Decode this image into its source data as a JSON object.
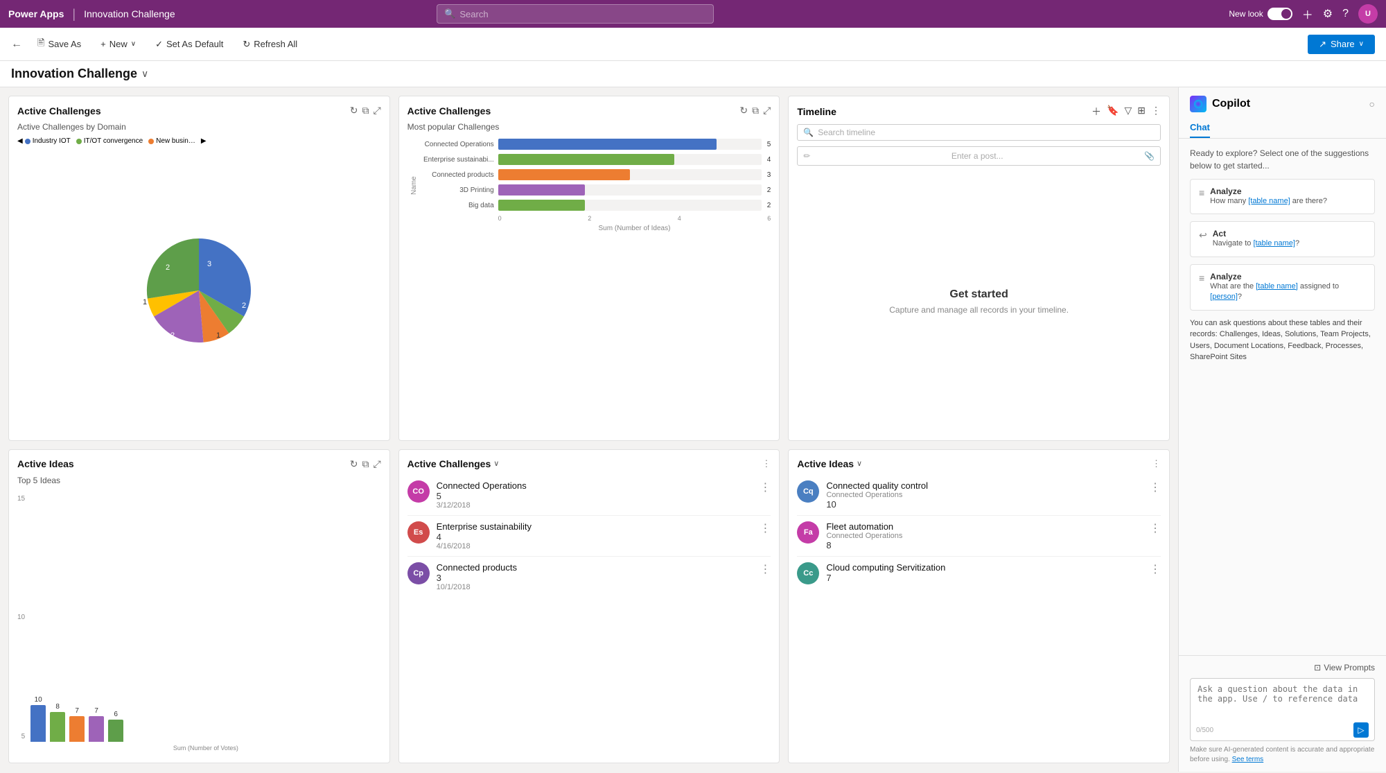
{
  "topnav": {
    "brand": "Power Apps",
    "separator": "|",
    "title": "Innovation Challenge",
    "search_placeholder": "Search",
    "new_look_label": "New look",
    "avatar_initials": "U"
  },
  "toolbar": {
    "back_icon": "←",
    "save_as_label": "Save As",
    "new_label": "New",
    "set_default_label": "Set As Default",
    "refresh_label": "Refresh All",
    "share_label": "Share"
  },
  "page": {
    "title": "Innovation Challenge",
    "chevron": "∨"
  },
  "active_challenges_pie": {
    "title": "Active Challenges",
    "subtitle": "Active Challenges by Domain",
    "legend": [
      {
        "label": "Industry IOT",
        "color": "#4472c4"
      },
      {
        "label": "IT/OT convergence",
        "color": "#70ad47"
      },
      {
        "label": "New busin…",
        "color": "#ed7d31"
      }
    ],
    "segments": [
      {
        "label": "3",
        "value": 3,
        "color": "#4472c4",
        "startAngle": 0,
        "endAngle": 120
      },
      {
        "label": "2",
        "value": 2,
        "color": "#70ad47",
        "startAngle": 120,
        "endAngle": 185
      },
      {
        "label": "1",
        "value": 1,
        "color": "#ed7d31",
        "startAngle": 185,
        "endAngle": 225
      },
      {
        "label": "2",
        "value": 2,
        "color": "#9e63b8",
        "startAngle": 225,
        "endAngle": 285
      },
      {
        "label": "1",
        "value": 1,
        "color": "#ffc000",
        "startAngle": 285,
        "endAngle": 310
      },
      {
        "label": "2",
        "value": 2,
        "color": "#5e9e4a",
        "startAngle": 310,
        "endAngle": 360
      }
    ]
  },
  "active_challenges_bar": {
    "title": "Active Challenges",
    "subtitle": "Most popular Challenges",
    "bars": [
      {
        "label": "Connected Operations",
        "value": 5,
        "max": 6,
        "color": "#4472c4"
      },
      {
        "label": "Enterprise sustainabi...",
        "value": 4,
        "max": 6,
        "color": "#70ad47"
      },
      {
        "label": "Connected products",
        "value": 3,
        "max": 6,
        "color": "#ed7d31"
      },
      {
        "label": "3D Printing",
        "value": 2,
        "max": 6,
        "color": "#9e63b8"
      },
      {
        "label": "Big data",
        "value": 2,
        "max": 6,
        "color": "#70ad47"
      }
    ],
    "axis_label": "Sum (Number of Ideas)",
    "axis_values": [
      "0",
      "2",
      "4",
      "6"
    ]
  },
  "timeline": {
    "title": "Timeline",
    "search_placeholder": "Search timeline",
    "post_placeholder": "Enter a post...",
    "empty_title": "Get started",
    "empty_subtitle": "Capture and manage all records in your timeline."
  },
  "active_challenges_list": {
    "title": "Active Challenges",
    "items": [
      {
        "initials": "CO",
        "color": "#c43ca7",
        "name": "Connected Operations",
        "count": "5",
        "date": "3/12/2018"
      },
      {
        "initials": "Es",
        "color": "#d14b4b",
        "name": "Enterprise sustainability",
        "count": "4",
        "date": "4/16/2018"
      },
      {
        "initials": "Cp",
        "color": "#7b4ea6",
        "name": "Connected products",
        "count": "3",
        "date": "10/1/2018"
      }
    ]
  },
  "active_ideas_list": {
    "title": "Active Ideas",
    "items": [
      {
        "initials": "Cq",
        "color": "#4a7fc1",
        "name": "Connected quality control",
        "parent": "Connected Operations",
        "count": "10"
      },
      {
        "initials": "Fa",
        "color": "#c43ca7",
        "name": "Fleet automation",
        "parent": "Connected Operations",
        "count": "8"
      },
      {
        "initials": "Cc",
        "color": "#3a9a8a",
        "name": "Cloud computing Servitization",
        "count": "7"
      }
    ]
  },
  "active_ideas_chart": {
    "title": "Active Ideas",
    "subtitle": "Top 5 Ideas",
    "bars": [
      {
        "value": 10,
        "max": 15,
        "color": "#4472c4"
      },
      {
        "value": 8,
        "max": 15,
        "color": "#70ad47"
      },
      {
        "value": 7,
        "max": 15,
        "color": "#ed7d31"
      },
      {
        "value": 7,
        "max": 15,
        "color": "#9e63b8"
      },
      {
        "value": 6,
        "max": 15,
        "color": "#70ad47"
      }
    ],
    "y_max": 15,
    "y_labels": [
      "15",
      "10",
      "5"
    ]
  },
  "copilot": {
    "title": "Copilot",
    "tabs": [
      "Chat"
    ],
    "intro": "Ready to explore? Select one of the suggestions below to get started...",
    "suggestions": [
      {
        "icon": "≡",
        "type": "Analyze",
        "text": "How many [table name] are there?"
      },
      {
        "icon": "↩",
        "type": "Act",
        "text": "Navigate to [table name]?"
      },
      {
        "icon": "≡",
        "type": "Analyze",
        "text": "What are the [table name] assigned to [person]?"
      }
    ],
    "info_text": "You can ask questions about these tables and their records: Challenges, Ideas, Solutions, Team Projects, Users, Document Locations, Feedback, Processes, SharePoint Sites",
    "view_prompts_label": "View Prompts",
    "input_placeholder": "Ask a question about the data in the app. Use / to reference data",
    "input_counter": "0/500",
    "disclaimer": "Make sure AI-generated content is accurate and appropriate before using.",
    "disclaimer_link": "See terms"
  }
}
